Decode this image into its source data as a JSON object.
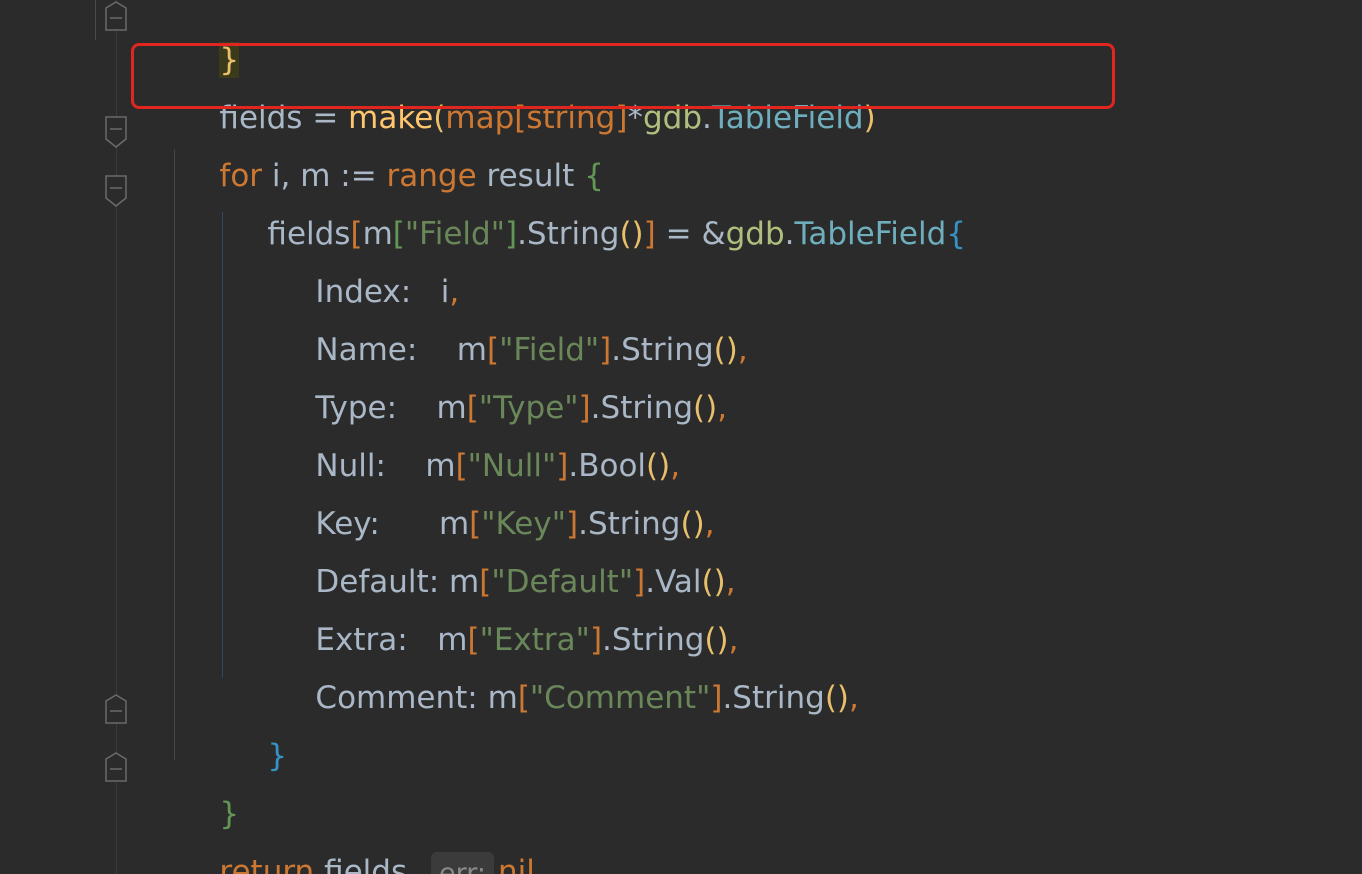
{
  "code": {
    "close_brace_top": "}",
    "line_make": {
      "ident": "fields",
      "assign": " = ",
      "make": "make",
      "paren_open": "(",
      "map": "map",
      "bracket_open": "[",
      "string": "string",
      "bracket_close": "]",
      "star": "*",
      "pkg": "gdb",
      "dot": ".",
      "type": "TableField",
      "paren_close": ")"
    },
    "line_for": {
      "for": "for",
      "vars": " i, m := ",
      "range": "range",
      "rest": " result ",
      "brace": "{"
    },
    "line_assign": {
      "fields": "fields",
      "lb": "[",
      "m": "m",
      "lb2": "[",
      "key": "\"Field\"",
      "rb2": "]",
      "call": ".String",
      "parens": "()",
      "rb": "]",
      "mid": " = &",
      "pkg": "gdb",
      "dot": ".",
      "type": "TableField",
      "brace": "{"
    },
    "fields": [
      {
        "name": "Index:",
        "pad": "   ",
        "expr": "i",
        "comma": ","
      },
      {
        "name": "Name:",
        "pad": "    ",
        "m": "m",
        "key": "\"Field\"",
        "call": ".String",
        "comma": ","
      },
      {
        "name": "Type:",
        "pad": "    ",
        "m": "m",
        "key": "\"Type\"",
        "call": ".String",
        "comma": ","
      },
      {
        "name": "Null:",
        "pad": "    ",
        "m": "m",
        "key": "\"Null\"",
        "call": ".Bool",
        "comma": ","
      },
      {
        "name": "Key:",
        "pad": "      ",
        "m": "m",
        "key": "\"Key\"",
        "call": ".String",
        "comma": ","
      },
      {
        "name": "Default:",
        "pad": " ",
        "m": "m",
        "key": "\"Default\"",
        "call": ".Val",
        "comma": ","
      },
      {
        "name": "Extra:",
        "pad": "   ",
        "m": "m",
        "key": "\"Extra\"",
        "call": ".String",
        "comma": ","
      },
      {
        "name": "Comment:",
        "pad": " ",
        "m": "m",
        "key": "\"Comment\"",
        "call": ".String",
        "comma": ","
      }
    ],
    "inner_close": "}",
    "outer_close": "}",
    "return_line": {
      "return": "return",
      "value": " fields",
      "comma": ",",
      "hint": "err:",
      "nil": "nil"
    }
  },
  "colors": {
    "background": "#2b2b2b",
    "keyword": "#cc7832",
    "function": "#ffc66d",
    "type": "#6fafbd",
    "string": "#6a8759",
    "highlight_box": "#e0261f"
  }
}
